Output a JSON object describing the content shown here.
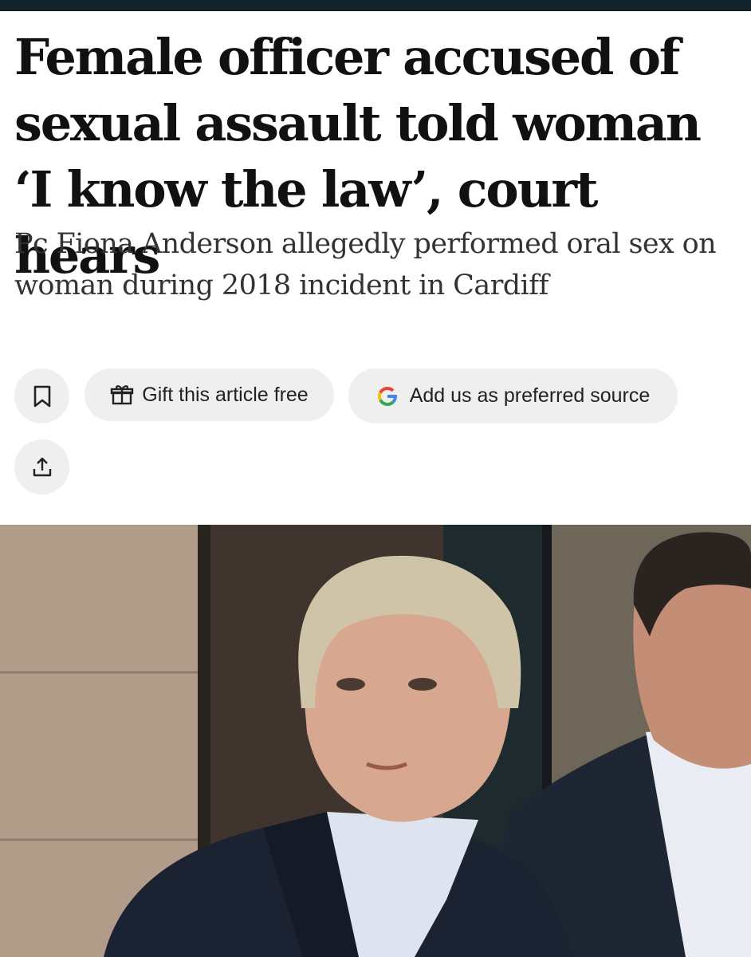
{
  "article": {
    "headline": "Female officer accused of sexual assault told woman ‘I know the law’, court hears",
    "standfirst": "Pc Fiona Anderson allegedly performed oral sex on woman during 2018 incident in Cardiff"
  },
  "actions": {
    "gift_label": "Gift this article free",
    "preferred_source_label": "Add us as preferred source",
    "bookmark_icon": "bookmark-icon",
    "gift_icon": "gift-icon",
    "google_icon": "google-logo-icon",
    "share_icon": "share-icon"
  },
  "colors": {
    "top_bar": "#14222c",
    "pill_background": "#efefef",
    "headline_text": "#111111",
    "standfirst_text": "#333333"
  }
}
